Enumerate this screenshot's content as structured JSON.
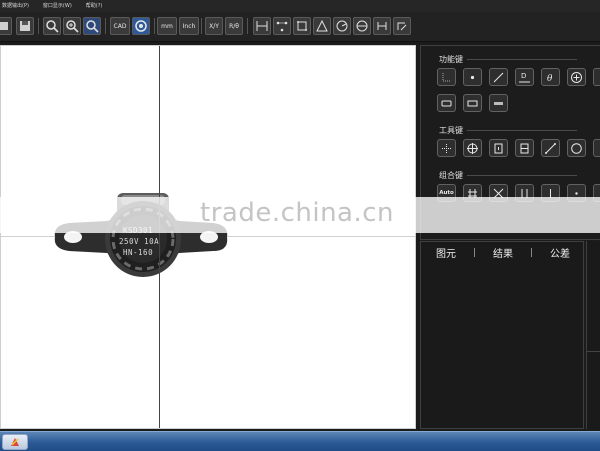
{
  "menubar": {
    "items": [
      "数据输出(P)",
      "窗口显示(W)",
      "帮助(?)"
    ]
  },
  "toolbar": {
    "cad_label": "CAD",
    "mm_label": "mm",
    "inch_label": "Inch",
    "xy_label": "X/Y",
    "ro_label": "R/θ"
  },
  "view": {
    "part_text": [
      "KSD301",
      "250V 10A",
      "HN-160"
    ]
  },
  "panel": {
    "sections": {
      "function_keys": "功能键",
      "tool_keys": "工具键",
      "combo_keys": "组合键"
    },
    "function_buttons": [
      "point-icon",
      "dot-icon",
      "line-icon",
      "distance-icon",
      "angle-icon",
      "plus-circle-icon",
      "rect-icon",
      "rect-icon",
      "bar-icon"
    ],
    "tool_buttons": [
      "grid-icon",
      "target-icon",
      "box-icon",
      "split-icon",
      "diagonal-icon",
      "circle-icon"
    ],
    "combo_auto_label": "Auto",
    "tabs": [
      "图元",
      "结果",
      "公差"
    ]
  },
  "watermark": {
    "text": "trade.china.cn"
  },
  "colors": {
    "background": "#1b1b1b",
    "canvas": "#ffffff",
    "taskbar": "#2b5a95"
  }
}
